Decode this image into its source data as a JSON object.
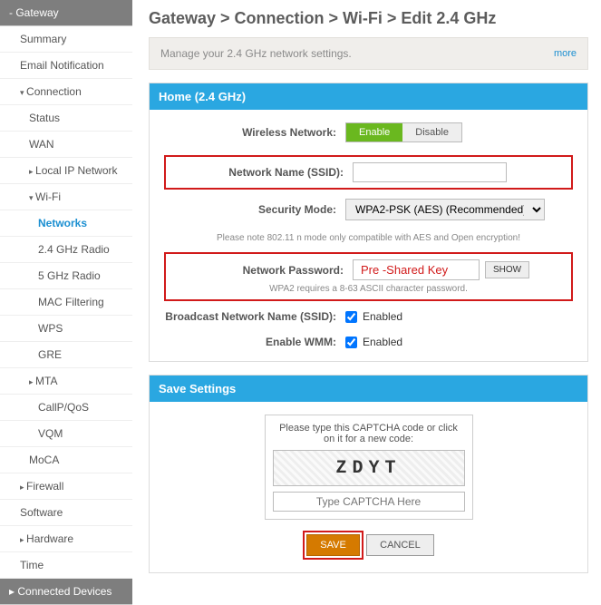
{
  "nav": {
    "section_gateway": "- Gateway",
    "items": [
      {
        "label": "Summary"
      },
      {
        "label": "Email Notification"
      },
      {
        "label": "Connection",
        "expanded": true
      },
      {
        "label": "Status"
      },
      {
        "label": "WAN"
      },
      {
        "label": "Local IP Network"
      },
      {
        "label": "Wi-Fi",
        "expanded": true
      },
      {
        "label": "Networks",
        "active": true
      },
      {
        "label": "2.4 GHz Radio"
      },
      {
        "label": "5 GHz Radio"
      },
      {
        "label": "MAC Filtering"
      },
      {
        "label": "WPS"
      },
      {
        "label": "GRE"
      },
      {
        "label": "MTA"
      },
      {
        "label": "CallP/QoS"
      },
      {
        "label": "VQM"
      },
      {
        "label": "MoCA"
      },
      {
        "label": "Firewall"
      },
      {
        "label": "Software"
      },
      {
        "label": "Hardware"
      },
      {
        "label": "Time"
      }
    ],
    "section_devices": "Connected Devices"
  },
  "breadcrumb": "Gateway > Connection > Wi-Fi > Edit 2.4 GHz",
  "notice": {
    "msg": "Manage your 2.4 GHz network settings.",
    "more": "more"
  },
  "panel_home": {
    "title": "Home (2.4 GHz)",
    "wireless_label": "Wireless Network:",
    "enable_label": "Enable",
    "disable_label": "Disable",
    "ssid_label": "Network Name (SSID):",
    "ssid_value": "",
    "security_label": "Security Mode:",
    "security_value": "WPA2-PSK (AES) (Recommended)",
    "security_hint": "Please note 802.11 n mode only compatible with AES and Open encryption!",
    "password_label": "Network Password:",
    "password_display": "Pre -Shared Key",
    "show_label": "SHOW",
    "password_hint": "WPA2 requires a 8-63 ASCII character password.",
    "broadcast_label": "Broadcast Network Name (SSID):",
    "broadcast_enabled": "Enabled",
    "wmm_label": "Enable WMM:",
    "wmm_enabled": "Enabled"
  },
  "panel_save": {
    "title": "Save Settings",
    "captcha_msg": "Please type this CAPTCHA code or click on it for a new code:",
    "captcha_text": "ZDYT",
    "captcha_placeholder": "Type CAPTCHA Here",
    "save_label": "SAVE",
    "cancel_label": "CANCEL"
  }
}
